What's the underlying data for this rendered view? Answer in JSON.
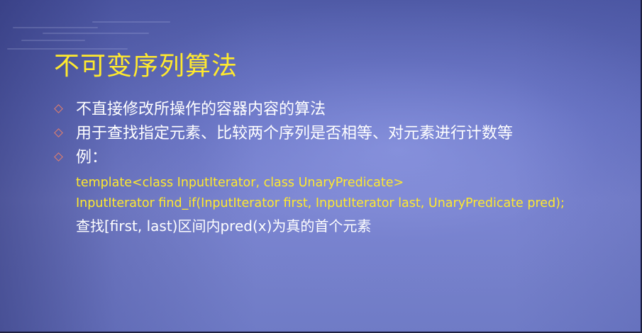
{
  "slide": {
    "title": "不可变序列算法",
    "bullets": [
      {
        "icon": "diamond-bullet-icon",
        "text": "不直接修改所操作的容器内容的算法"
      },
      {
        "icon": "diamond-bullet-icon",
        "text": "用于查找指定元素、比较两个序列是否相等、对元素进行计数等"
      },
      {
        "icon": "diamond-bullet-icon",
        "text": "例："
      }
    ],
    "code_lines": [
      "template<class InputIterator, class UnaryPredicate>",
      "InputIterator find_if(InputIterator first, InputIterator last, UnaryPredicate pred);"
    ],
    "description": "查找[first, last)区间内pred(x)为真的首个元素"
  },
  "colors": {
    "title": "#ffe92e",
    "code": "#ffe92e",
    "body_text": "#ffffff",
    "bullet": "#e8806a",
    "background": "#6a76c4"
  }
}
